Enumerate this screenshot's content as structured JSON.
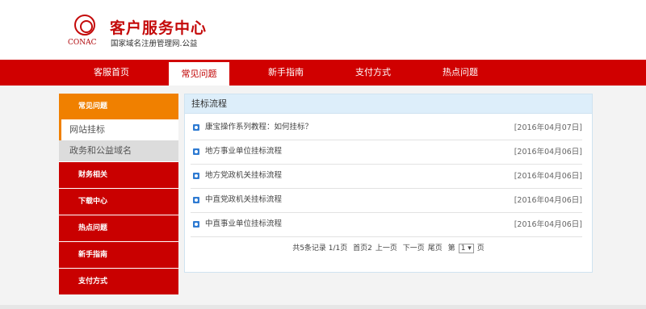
{
  "header": {
    "logo_text": "CONAC",
    "title": "客户服务中心",
    "subtitle": "国家域名注册管理网.公益"
  },
  "nav": [
    {
      "label": "客服首页"
    },
    {
      "label": "常见问题"
    },
    {
      "label": "新手指南"
    },
    {
      "label": "支付方式"
    },
    {
      "label": "热点问题"
    }
  ],
  "sidebar": {
    "section": "常见问题",
    "subitems": [
      {
        "label": "网站挂标"
      },
      {
        "label": "政务和公益域名"
      }
    ],
    "items": [
      {
        "label": "财务相关"
      },
      {
        "label": "下载中心"
      },
      {
        "label": "热点问题"
      },
      {
        "label": "新手指南"
      },
      {
        "label": "支付方式"
      }
    ]
  },
  "content": {
    "title": "挂标流程",
    "articles": [
      {
        "title": "康宝操作系列教程：如何挂标？",
        "date": "[2016年04月07日]"
      },
      {
        "title": "地方事业单位挂标流程",
        "date": "[2016年04月06日]"
      },
      {
        "title": "地方党政机关挂标流程",
        "date": "[2016年04月06日]"
      },
      {
        "title": "中直党政机关挂标流程",
        "date": "[2016年04月06日]"
      },
      {
        "title": "中直事业单位挂标流程",
        "date": "[2016年04月06日]"
      }
    ],
    "pager": {
      "summary": "共5条记录 1/1页",
      "first": "首页2",
      "prev": "上一页",
      "next": "下一页",
      "last": "尾页",
      "page_prefix": "第",
      "page_value": "1 ▾",
      "page_suffix": "页"
    }
  },
  "colors": {
    "brand_red": "#d00000",
    "accent_orange": "#f08000",
    "link_icon_blue": "#2f7bd2"
  }
}
